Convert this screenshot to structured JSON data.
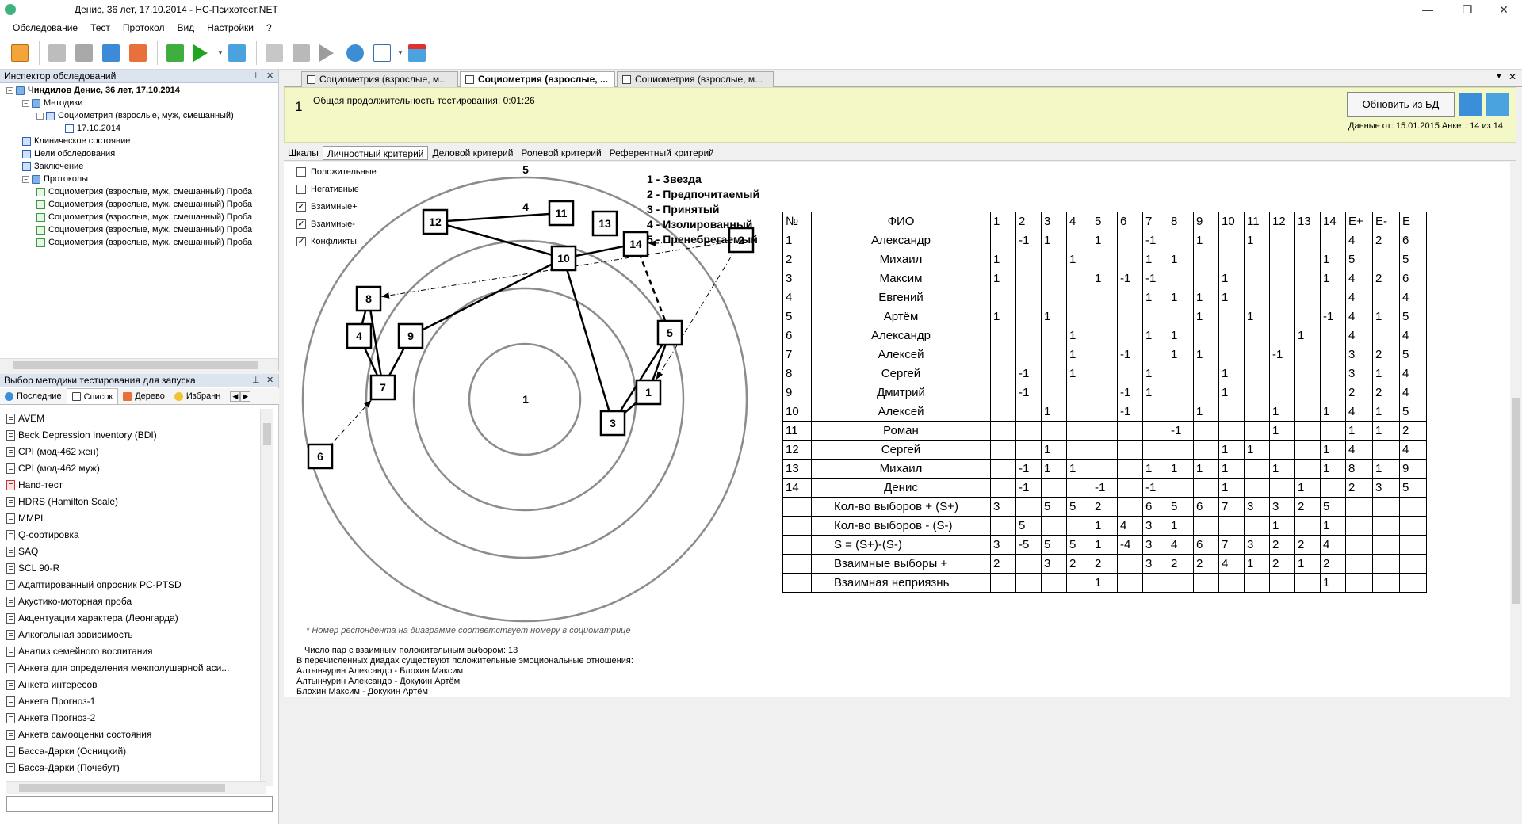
{
  "window": {
    "title": "Денис, 36 лет, 17.10.2014 - НС-Психотест.NET"
  },
  "menu": [
    "Обследование",
    "Тест",
    "Протокол",
    "Вид",
    "Настройки",
    "?"
  ],
  "toolbar_icons": [
    "open-folder-icon",
    "print-icon",
    "gear-print-icon",
    "save-icon",
    "export-icon",
    "run-list-icon",
    "play-icon",
    "network-icon",
    "grid-icon",
    "chart-icon",
    "step-icon",
    "settings-icon",
    "report-icon",
    "close-window-icon"
  ],
  "inspector": {
    "title": "Инспектор обследований",
    "items": [
      {
        "label": "Чиндилов Денис, 36 лет, 17.10.2014",
        "depth": 0
      },
      {
        "label": "Методики",
        "depth": 1
      },
      {
        "label": "Социометрия (взрослые, муж, смешанный)",
        "depth": 2
      },
      {
        "label": "17.10.2014",
        "depth": 3
      },
      {
        "label": "Клиническое состояние",
        "depth": 1
      },
      {
        "label": "Цели обследования",
        "depth": 1
      },
      {
        "label": "Заключение",
        "depth": 1
      },
      {
        "label": "Протоколы",
        "depth": 1
      },
      {
        "label": "Социометрия (взрослые, муж, смешанный) Проба",
        "depth": 2
      },
      {
        "label": "Социометрия (взрослые, муж, смешанный) Проба",
        "depth": 2
      },
      {
        "label": "Социометрия (взрослые, муж, смешанный) Проба",
        "depth": 2
      },
      {
        "label": "Социометрия (взрослые, муж, смешанный) Проба",
        "depth": 2
      },
      {
        "label": "Социометрия (взрослые, муж, смешанный) Проба",
        "depth": 2
      }
    ]
  },
  "selector": {
    "title": "Выбор методики тестирования для запуска",
    "tabs": [
      "Последние",
      "Список",
      "Дерево",
      "Избранн"
    ],
    "methods": [
      "AVEM",
      "Beck Depression Inventory (BDI)",
      "CPI (мод-462 жен)",
      "CPI (мод-462 муж)",
      "Hand-тест",
      "HDRS (Hamilton Scale)",
      "MMPI",
      "Q-сортировка",
      "SAQ",
      "SCL 90-R",
      "Адаптированный опросник PC-PTSD",
      "Акустико-моторная проба",
      "Акцентуации характера (Леонгарда)",
      "Алкогольная зависимость",
      "Анализ семейного воспитания",
      "Анкета для определения межполушарной аси...",
      "Анкета интересов",
      "Анкета Прогноз-1",
      "Анкета Прогноз-2",
      "Анкета самооценки состояния",
      "Басса-Дарки (Осницкий)",
      "Басса-Дарки (Почебут)"
    ]
  },
  "docTabs": [
    "Социометрия (взрослые, м...",
    "Социометрия (взрослые, ...",
    "Социометрия (взрослые, м..."
  ],
  "header": {
    "number": "1",
    "duration": "Общая продолжительность тестирования: 0:01:26",
    "refresh": "Обновить из БД",
    "info": "Данные от: 15.01.2015 Анкет: 14 из 14"
  },
  "criteriaTabs": [
    "Шкалы",
    "Личностный критерий",
    "Деловой критерий",
    "Ролевой критерий",
    "Референтный критерий"
  ],
  "checkboxes": [
    {
      "label": "Положительные",
      "checked": false
    },
    {
      "label": "Негативные",
      "checked": false
    },
    {
      "label": "Взаимные+",
      "checked": true
    },
    {
      "label": "Взаимные-",
      "checked": true
    },
    {
      "label": "Конфликты",
      "checked": true
    }
  ],
  "checkmark": "✓",
  "diagram": {
    "rings": [
      "5",
      "4",
      "1"
    ],
    "legend": [
      "1 - Звезда",
      "2 - Предпочитаемый",
      "3 - Принятый",
      "4 - Изолированный",
      "5 - Пренебрегаемый"
    ],
    "nodes": [
      "1",
      "2",
      "3",
      "4",
      "5",
      "6",
      "7",
      "8",
      "9",
      "10",
      "11",
      "12",
      "13",
      "14"
    ],
    "footnote": "* Номер респондента на диаграмме соответствует номеру в социоматрице"
  },
  "table": {
    "headers": [
      "№",
      "ФИО",
      "1",
      "2",
      "3",
      "4",
      "5",
      "6",
      "7",
      "8",
      "9",
      "10",
      "11",
      "12",
      "13",
      "14",
      "E+",
      "E-",
      "E"
    ],
    "rows": [
      [
        "1",
        "Александр",
        "",
        "-1",
        "1",
        "",
        "1",
        "",
        "-1",
        "",
        "1",
        "",
        "1",
        "",
        "",
        "",
        "4",
        "2",
        "6"
      ],
      [
        "2",
        "Михаил",
        "1",
        "",
        "",
        "1",
        "",
        "",
        "1",
        "1",
        "",
        "",
        "",
        "",
        "",
        "1",
        "5",
        "",
        "5"
      ],
      [
        "3",
        "Максим",
        "1",
        "",
        "",
        "",
        "1",
        "-1",
        "-1",
        "",
        "",
        "1",
        "",
        "",
        "",
        "1",
        "4",
        "2",
        "6"
      ],
      [
        "4",
        "Евгений",
        "",
        "",
        "",
        "",
        "",
        "",
        "1",
        "1",
        "1",
        "1",
        "",
        "",
        "",
        "",
        "4",
        "",
        "4"
      ],
      [
        "5",
        "Артём",
        "1",
        "",
        "1",
        "",
        "",
        "",
        "",
        "",
        "1",
        "",
        "1",
        "",
        "",
        "-1",
        "4",
        "1",
        "5"
      ],
      [
        "6",
        "Александр",
        "",
        "",
        "",
        "1",
        "",
        "",
        "1",
        "1",
        "",
        "",
        "",
        "",
        "1",
        "",
        "4",
        "",
        "4"
      ],
      [
        "7",
        "Алексей",
        "",
        "",
        "",
        "1",
        "",
        "-1",
        "",
        "1",
        "1",
        "",
        "",
        "-1",
        "",
        "",
        "3",
        "2",
        "5"
      ],
      [
        "8",
        "Сергей",
        "",
        "-1",
        "",
        "1",
        "",
        "",
        "1",
        "",
        "",
        "1",
        "",
        "",
        "",
        "",
        "3",
        "1",
        "4"
      ],
      [
        "9",
        "Дмитрий",
        "",
        "-1",
        "",
        "",
        "",
        "-1",
        "1",
        "",
        "",
        "1",
        "",
        "",
        "",
        "",
        "2",
        "2",
        "4"
      ],
      [
        "10",
        "Алексей",
        "",
        "",
        "1",
        "",
        "",
        "-1",
        "",
        "",
        "1",
        "",
        "",
        "1",
        "",
        "1",
        "4",
        "1",
        "5"
      ],
      [
        "11",
        "Роман",
        "",
        "",
        "",
        "",
        "",
        "",
        "",
        "-1",
        "",
        "",
        "",
        "1",
        "",
        "",
        "1",
        "1",
        "2"
      ],
      [
        "12",
        "Сергей",
        "",
        "",
        "1",
        "",
        "",
        "",
        "",
        "",
        "",
        "1",
        "1",
        "",
        "",
        "1",
        "4",
        "",
        "4"
      ],
      [
        "13",
        "Михаил",
        "",
        "-1",
        "1",
        "1",
        "",
        "",
        "1",
        "1",
        "1",
        "1",
        "",
        "1",
        "",
        "1",
        "8",
        "1",
        "9"
      ],
      [
        "14",
        "Денис",
        "",
        "-1",
        "",
        "",
        "-1",
        "",
        "-1",
        "",
        "",
        "1",
        "",
        "",
        "1",
        "",
        "2",
        "3",
        "5"
      ]
    ],
    "summary": [
      {
        "label": "Кол-во выборов + (S+)",
        "values": [
          "3",
          "",
          "5",
          "5",
          "2",
          "",
          "6",
          "5",
          "6",
          "7",
          "3",
          "3",
          "2",
          "5"
        ]
      },
      {
        "label": "Кол-во выборов - (S-)",
        "values": [
          "",
          "5",
          "",
          "",
          "1",
          "4",
          "3",
          "1",
          "",
          "",
          "",
          "1",
          "",
          "1"
        ]
      },
      {
        "label": "S = (S+)-(S-)",
        "values": [
          "3",
          "-5",
          "5",
          "5",
          "1",
          "-4",
          "3",
          "4",
          "6",
          "7",
          "3",
          "2",
          "2",
          "4"
        ]
      },
      {
        "label": "Взаимные выборы +",
        "values": [
          "2",
          "",
          "3",
          "2",
          "2",
          "",
          "3",
          "2",
          "2",
          "4",
          "1",
          "2",
          "1",
          "2"
        ]
      },
      {
        "label": "Взаимная неприязнь",
        "values": [
          "",
          "",
          "",
          "",
          "1",
          "",
          "",
          "",
          "",
          "",
          "",
          "",
          "",
          "1"
        ]
      }
    ]
  },
  "notes": [
    "Число пар с взаимным положительным выбором: 13",
    "В перечисленных диадах существуют положительные эмоциональные отношения:",
    "Алтынчурин Александр - Блохин Максим",
    "Алтынчурин Александр - Докукин Артём",
    "Блохин Максим - Докукин Артём"
  ]
}
